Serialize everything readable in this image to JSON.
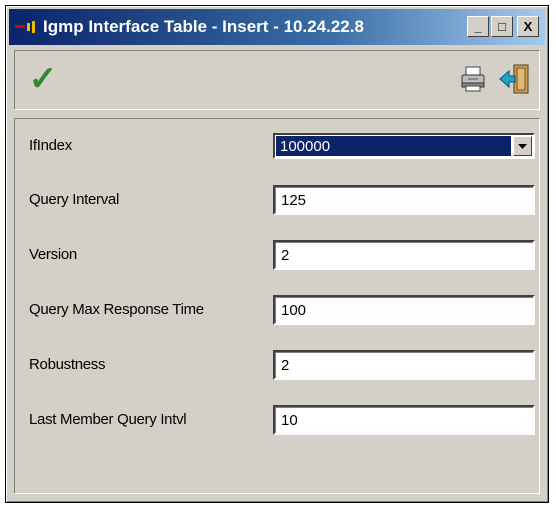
{
  "window": {
    "title": "Igmp Interface Table - Insert - 10.24.22.8",
    "controls": {
      "minimize": "_",
      "maximize": "□",
      "close": "X"
    }
  },
  "toolbar": {
    "apply_icon": "check-icon",
    "print_icon": "printer-icon",
    "exit_icon": "exit-door-icon",
    "apply_glyph": "✓"
  },
  "form": {
    "ifindex": {
      "label": "IfIndex",
      "value": "100000"
    },
    "query_interval": {
      "label": "Query Interval",
      "value": "125"
    },
    "version": {
      "label": "Version",
      "value": "2"
    },
    "query_max_response_time": {
      "label": "Query Max Response Time",
      "value": "100"
    },
    "robustness": {
      "label": "Robustness",
      "value": "2"
    },
    "last_member_query_intvl": {
      "label": "Last Member Query Intvl",
      "value": "10"
    }
  },
  "colors": {
    "titlebar_start": "#0a246a",
    "titlebar_end": "#a6caf0",
    "check": "#2e8b2e",
    "selection": "#0a246a"
  }
}
